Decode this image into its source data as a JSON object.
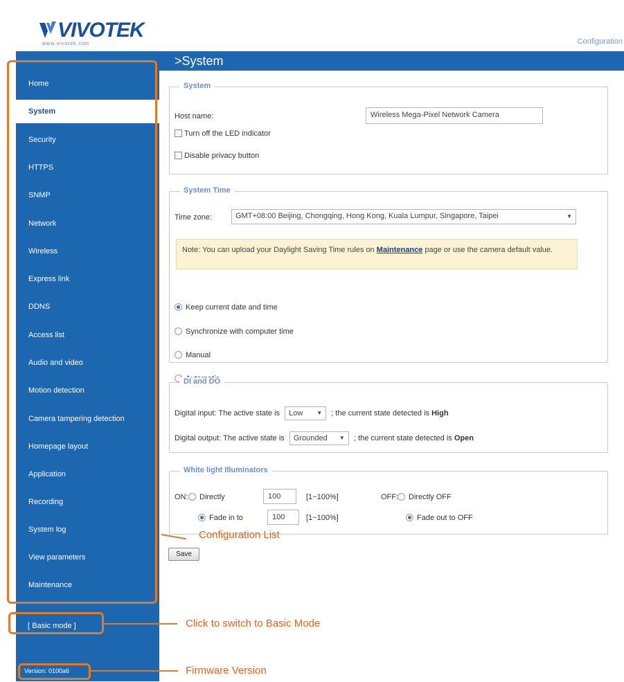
{
  "brand": {
    "logo_text": "VIVOTEK",
    "logo_sub": "www.vivotek.com"
  },
  "header": {
    "config_link": "Configuration"
  },
  "page_title": ">System",
  "sidebar": {
    "items": [
      {
        "label": "Home"
      },
      {
        "label": "System"
      },
      {
        "label": "Security"
      },
      {
        "label": "HTTPS"
      },
      {
        "label": "SNMP"
      },
      {
        "label": "Network"
      },
      {
        "label": "Wireless"
      },
      {
        "label": "Express link"
      },
      {
        "label": "DDNS"
      },
      {
        "label": "Access list"
      },
      {
        "label": "Audio and video"
      },
      {
        "label": "Motion detection"
      },
      {
        "label": "Camera tampering detection"
      },
      {
        "label": "Homepage layout"
      },
      {
        "label": "Application"
      },
      {
        "label": "Recording"
      },
      {
        "label": "System log"
      },
      {
        "label": "View parameters"
      },
      {
        "label": "Maintenance"
      }
    ],
    "active": "System",
    "basic_mode": "[ Basic mode ]",
    "version": "Version: 0100a6"
  },
  "system": {
    "legend": "System",
    "host_label": "Host name:",
    "host_value": "Wireless Mega-Pixel Network Camera",
    "led_label": "Turn off the LED indicator",
    "privacy_label": "Disable privacy button"
  },
  "system_time": {
    "legend": "System Time",
    "timezone_label": "Time zone:",
    "timezone_value": "GMT+08:00 Beijing, Chongqing, Hong Kong, Kuala Lumpur, Singapore, Taipei",
    "note_prefix": "Note: You can upload your Daylight Saving Time rules on ",
    "note_link": "Maintenance",
    "note_suffix": " page or use the camera default value.",
    "options": [
      {
        "label": "Keep current date and time",
        "selected": true
      },
      {
        "label": "Synchronize with computer time",
        "selected": false
      },
      {
        "label": "Manual",
        "selected": false
      },
      {
        "label": "Automatic",
        "selected": false
      }
    ]
  },
  "di_do": {
    "legend": "DI and DO",
    "di_prefix": "Digital input: The active state is",
    "di_select": "Low",
    "di_suffix": "; the current state detected is",
    "di_state": "High",
    "do_prefix": "Digital output: The active state is",
    "do_select": "Grounded",
    "do_suffix": "; the current state detected is",
    "do_state": "Open"
  },
  "white_light": {
    "legend": "White light Illuminators",
    "on_label": "ON:",
    "directly_label": "Directly",
    "directly_value": "100",
    "directly_range": "[1~100%]",
    "fadein_label": "Fade in to",
    "fadein_value": "100",
    "fadein_range": "[1~100%]",
    "off_label": "OFF:",
    "directly_off_label": "Directly OFF",
    "fadeout_label": "Fade out to OFF"
  },
  "save_label": "Save",
  "callouts": {
    "config_list": "Configuration List",
    "basic_mode": "Click to switch to Basic Mode",
    "firmware": "Firmware Version"
  },
  "colors": {
    "nav_blue": "#1d67b1",
    "callout_orange": "#e07b2a",
    "note_bg": "#fbf3d2"
  }
}
